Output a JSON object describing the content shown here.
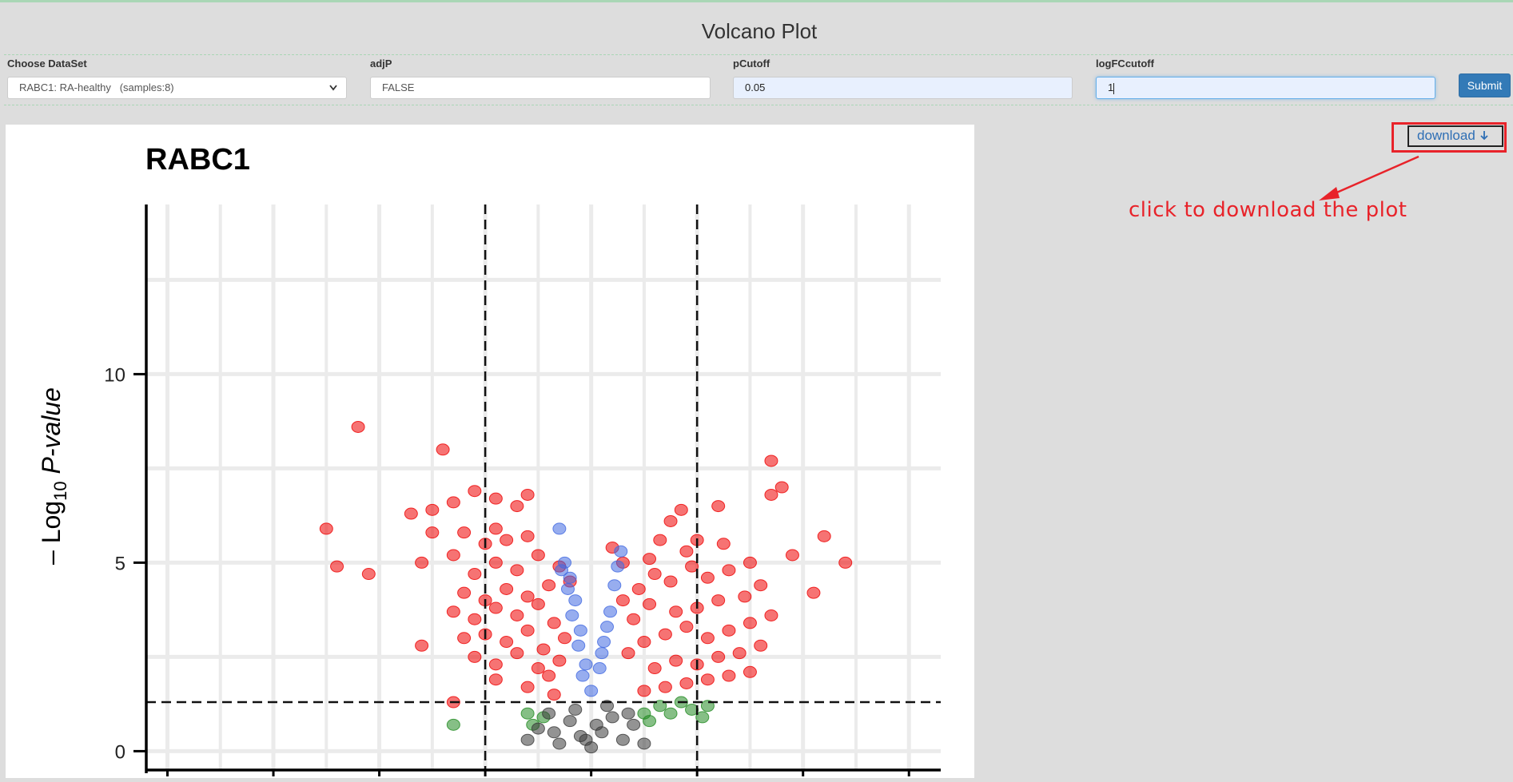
{
  "page": {
    "title": "Volcano Plot"
  },
  "form": {
    "dataset": {
      "label": "Choose DataSet",
      "value": "RABC1: RA-healthy   (samples:8)"
    },
    "adjp": {
      "label": "adjP",
      "value": "FALSE"
    },
    "pcutoff": {
      "label": "pCutoff",
      "value": "0.05"
    },
    "logfc": {
      "label": "logFCcutoff",
      "value": "1"
    },
    "submit_label": "Submit"
  },
  "download": {
    "label": "download"
  },
  "annotation": {
    "text": "click to download the plot"
  },
  "colors": {
    "background": "#dddddd",
    "accent": "#337ab7",
    "annotation_red": "#e8232a",
    "point_sig": "#ee0000",
    "point_p_only": "#4169e1",
    "point_fc_only": "#228b22",
    "point_ns": "#3a3a3a"
  },
  "chart_data": {
    "type": "scatter",
    "title": "RABC1",
    "ylabel_prefix": "– Log",
    "ylabel_sub": "10",
    "ylabel_italic": "P-value",
    "xlabel": "",
    "yticks": [
      0,
      5,
      10
    ],
    "ylim": [
      -0.5,
      14.5
    ],
    "xlim": [
      -4.2,
      3.3
    ],
    "cutoffs": {
      "logfc": 1,
      "neglog10p": 1.3
    },
    "series": [
      {
        "color": "#ee0000",
        "points": [
          [
            -2.2,
            8.6
          ],
          [
            -1.4,
            8.0
          ],
          [
            -2.5,
            5.9
          ],
          [
            -2.4,
            4.9
          ],
          [
            -2.1,
            4.7
          ],
          [
            -1.7,
            6.3
          ],
          [
            -1.5,
            6.4
          ],
          [
            -1.3,
            6.6
          ],
          [
            -1.1,
            6.9
          ],
          [
            -0.9,
            6.7
          ],
          [
            -0.7,
            6.5
          ],
          [
            -0.6,
            6.8
          ],
          [
            -1.5,
            5.8
          ],
          [
            -1.2,
            5.8
          ],
          [
            -1.0,
            5.5
          ],
          [
            -0.9,
            5.9
          ],
          [
            -0.8,
            5.6
          ],
          [
            -0.6,
            5.7
          ],
          [
            -1.6,
            5.0
          ],
          [
            -1.3,
            5.2
          ],
          [
            -1.1,
            4.7
          ],
          [
            -0.9,
            5.0
          ],
          [
            -0.7,
            4.8
          ],
          [
            -0.5,
            5.2
          ],
          [
            -1.2,
            4.2
          ],
          [
            -1.0,
            4.0
          ],
          [
            -0.8,
            4.3
          ],
          [
            -0.6,
            4.1
          ],
          [
            -0.4,
            4.4
          ],
          [
            -0.3,
            4.9
          ],
          [
            -1.3,
            3.7
          ],
          [
            -1.1,
            3.5
          ],
          [
            -0.9,
            3.8
          ],
          [
            -0.7,
            3.6
          ],
          [
            -0.5,
            3.9
          ],
          [
            -0.35,
            3.4
          ],
          [
            -1.6,
            2.8
          ],
          [
            -1.2,
            3.0
          ],
          [
            -1.0,
            3.1
          ],
          [
            -0.8,
            2.9
          ],
          [
            -0.6,
            3.2
          ],
          [
            -0.45,
            2.7
          ],
          [
            -1.1,
            2.5
          ],
          [
            -0.9,
            2.3
          ],
          [
            -0.7,
            2.6
          ],
          [
            -0.5,
            2.2
          ],
          [
            -0.4,
            2.0
          ],
          [
            -0.3,
            2.4
          ],
          [
            -1.3,
            1.3
          ],
          [
            -0.9,
            1.9
          ],
          [
            -0.6,
            1.7
          ],
          [
            -0.35,
            1.5
          ],
          [
            -0.25,
            3.0
          ],
          [
            -0.2,
            4.5
          ],
          [
            1.7,
            7.7
          ],
          [
            1.8,
            7.0
          ],
          [
            1.7,
            6.8
          ],
          [
            1.2,
            6.5
          ],
          [
            0.85,
            6.4
          ],
          [
            0.75,
            6.1
          ],
          [
            2.2,
            5.7
          ],
          [
            2.4,
            5.0
          ],
          [
            2.1,
            4.2
          ],
          [
            1.9,
            5.2
          ],
          [
            1.25,
            5.5
          ],
          [
            1.0,
            5.6
          ],
          [
            0.9,
            5.3
          ],
          [
            0.65,
            5.6
          ],
          [
            0.55,
            5.1
          ],
          [
            1.5,
            5.0
          ],
          [
            1.3,
            4.8
          ],
          [
            1.1,
            4.6
          ],
          [
            0.95,
            4.9
          ],
          [
            0.75,
            4.5
          ],
          [
            0.6,
            4.7
          ],
          [
            0.45,
            4.3
          ],
          [
            1.6,
            4.4
          ],
          [
            1.45,
            4.1
          ],
          [
            1.2,
            4.0
          ],
          [
            1.0,
            3.8
          ],
          [
            0.8,
            3.7
          ],
          [
            0.55,
            3.9
          ],
          [
            0.4,
            3.5
          ],
          [
            1.7,
            3.6
          ],
          [
            1.5,
            3.4
          ],
          [
            1.3,
            3.2
          ],
          [
            1.1,
            3.0
          ],
          [
            0.9,
            3.3
          ],
          [
            0.7,
            3.1
          ],
          [
            0.5,
            2.9
          ],
          [
            1.6,
            2.8
          ],
          [
            1.4,
            2.6
          ],
          [
            1.2,
            2.5
          ],
          [
            1.0,
            2.3
          ],
          [
            0.8,
            2.4
          ],
          [
            0.6,
            2.2
          ],
          [
            1.5,
            2.1
          ],
          [
            1.3,
            2.0
          ],
          [
            1.1,
            1.9
          ],
          [
            0.9,
            1.8
          ],
          [
            0.7,
            1.7
          ],
          [
            0.5,
            1.6
          ],
          [
            0.35,
            2.6
          ],
          [
            0.3,
            4.0
          ],
          [
            0.3,
            5.0
          ],
          [
            0.2,
            5.4
          ]
        ]
      },
      {
        "color": "#4169e1",
        "points": [
          [
            -0.3,
            5.9
          ],
          [
            -0.25,
            5.0
          ],
          [
            -0.2,
            4.6
          ],
          [
            -0.15,
            4.0
          ],
          [
            -0.1,
            3.2
          ],
          [
            -0.05,
            2.3
          ],
          [
            -0.22,
            4.3
          ],
          [
            -0.18,
            3.6
          ],
          [
            -0.12,
            2.8
          ],
          [
            -0.08,
            2.0
          ],
          [
            0.0,
            1.6
          ],
          [
            0.08,
            2.2
          ],
          [
            0.12,
            2.9
          ],
          [
            0.18,
            3.7
          ],
          [
            0.22,
            4.4
          ],
          [
            0.25,
            4.9
          ],
          [
            0.28,
            5.3
          ],
          [
            0.15,
            3.3
          ],
          [
            0.1,
            2.6
          ],
          [
            -0.28,
            4.8
          ]
        ]
      },
      {
        "color": "#228b22",
        "points": [
          [
            -1.3,
            0.7
          ],
          [
            -0.6,
            1.0
          ],
          [
            -0.55,
            0.7
          ],
          [
            -0.45,
            0.9
          ],
          [
            0.65,
            1.2
          ],
          [
            0.75,
            1.0
          ],
          [
            0.85,
            1.3
          ],
          [
            0.95,
            1.1
          ],
          [
            1.05,
            0.9
          ],
          [
            0.55,
            0.8
          ],
          [
            1.1,
            1.2
          ],
          [
            0.5,
            1.0
          ]
        ]
      },
      {
        "color": "#3a3a3a",
        "points": [
          [
            -0.6,
            0.3
          ],
          [
            -0.5,
            0.6
          ],
          [
            -0.4,
            1.0
          ],
          [
            -0.3,
            0.2
          ],
          [
            -0.2,
            0.8
          ],
          [
            -0.1,
            0.4
          ],
          [
            0.0,
            0.1
          ],
          [
            0.1,
            0.5
          ],
          [
            0.2,
            0.9
          ],
          [
            0.3,
            0.3
          ],
          [
            0.4,
            0.7
          ],
          [
            0.5,
            0.2
          ],
          [
            -0.15,
            1.1
          ],
          [
            0.15,
            1.2
          ],
          [
            -0.35,
            0.5
          ],
          [
            0.35,
            1.0
          ],
          [
            0.05,
            0.7
          ],
          [
            -0.05,
            0.3
          ]
        ]
      }
    ]
  }
}
